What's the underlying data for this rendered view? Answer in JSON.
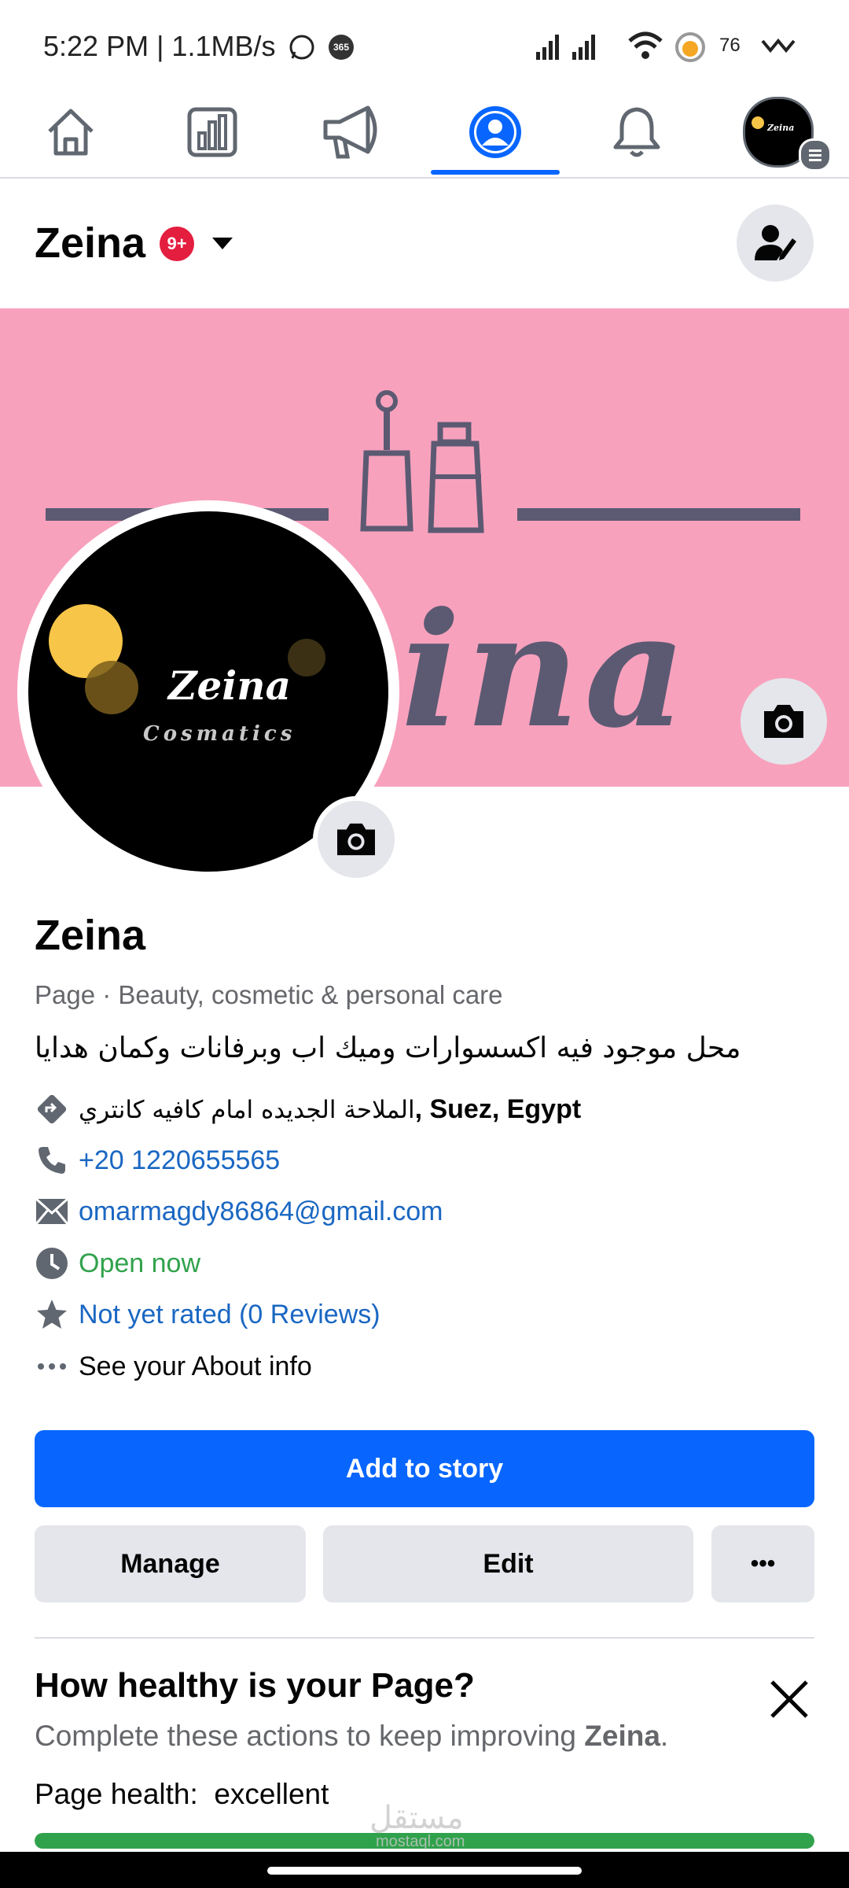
{
  "status_bar": {
    "time": "5:22 PM | 1.1MB/s",
    "app_badge": "365",
    "battery": "76"
  },
  "nav": {
    "tabs": [
      {
        "name": "home",
        "icon": "home-icon"
      },
      {
        "name": "insights",
        "icon": "bar-chart-icon"
      },
      {
        "name": "promote",
        "icon": "megaphone-icon"
      },
      {
        "name": "profile",
        "icon": "profile-icon",
        "active": true
      },
      {
        "name": "notifications",
        "icon": "bell-icon"
      },
      {
        "name": "menu",
        "icon": "avatar-menu-icon"
      }
    ],
    "avatar_text": "Zeina"
  },
  "header": {
    "page_name": "Zeina",
    "badge": "9+"
  },
  "cover": {
    "text": "ina",
    "background_color": "#f8a1bd"
  },
  "profile_picture": {
    "name": "Zeina",
    "subtitle": "Cosmatics"
  },
  "page_info": {
    "title": "Zeina",
    "category": "Page · Beauty, cosmetic & personal care",
    "bio": "محل موجود فيه اكسسوارات وميك اب وبرفانات وكمان هدايا",
    "address_ar": "الملاحة الجديده امام كافيه كانتري",
    "address_en": ", Suez, Egypt",
    "phone": "+20 1220655565",
    "email": "omarmagdy86864@gmail.com",
    "hours": "Open now",
    "rating": "Not yet rated (0 Reviews)",
    "about": "See your About info"
  },
  "actions": {
    "add_to_story": "Add to story",
    "manage": "Manage",
    "edit": "Edit",
    "more": "•••"
  },
  "health": {
    "title": "How healthy is your Page?",
    "subtitle_prefix": "Complete these actions to keep improving ",
    "subtitle_name": "Zeina",
    "subtitle_suffix": ".",
    "status_label": "Page health:",
    "status_value": "excellent",
    "progress": 1.0
  },
  "watermark": {
    "text": "مستقل",
    "url": "mostaql.com"
  },
  "colors": {
    "accent": "#0866ff",
    "link": "#1a67c2",
    "success": "#31a24c",
    "badge": "#e41e3f"
  }
}
